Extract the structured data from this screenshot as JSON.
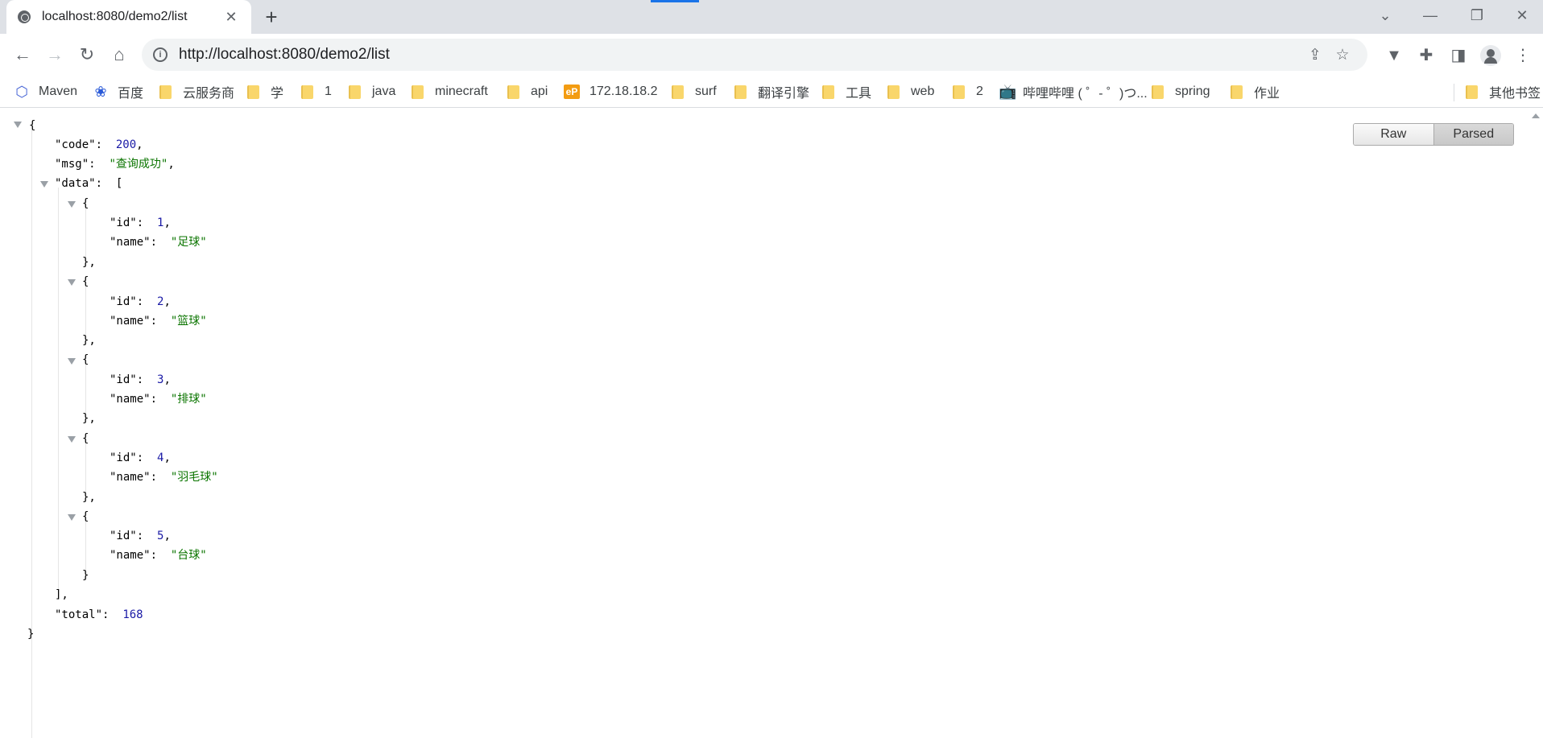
{
  "browser": {
    "tab": {
      "title": "localhost:8080/demo2/list"
    },
    "url": "http://localhost:8080/demo2/list",
    "bookmarks": [
      {
        "label": "Maven",
        "icon": "hexagon-icon"
      },
      {
        "label": "百度",
        "icon": "baidu-paw-icon"
      },
      {
        "label": "云服务商",
        "icon": "folder-icon"
      },
      {
        "label": "学",
        "icon": "folder-icon"
      },
      {
        "label": "1",
        "icon": "folder-icon"
      },
      {
        "label": "java",
        "icon": "folder-icon"
      },
      {
        "label": "minecraft",
        "icon": "folder-icon"
      },
      {
        "label": "api",
        "icon": "folder-icon"
      },
      {
        "label": "172.18.18.2",
        "icon": "ep-icon"
      },
      {
        "label": "surf",
        "icon": "folder-icon"
      },
      {
        "label": "翻译引擎",
        "icon": "folder-icon"
      },
      {
        "label": "工具",
        "icon": "folder-icon"
      },
      {
        "label": "web",
        "icon": "folder-icon"
      },
      {
        "label": "2",
        "icon": "folder-icon"
      },
      {
        "label": "哔哩哔哩 ( ゜- ゜)つ...",
        "icon": "bilibili-icon"
      },
      {
        "label": "spring",
        "icon": "folder-icon"
      },
      {
        "label": "作业",
        "icon": "folder-icon"
      }
    ],
    "other_bookmarks": "其他书签",
    "ep_text": "eP"
  },
  "viewer": {
    "raw_label": "Raw",
    "parsed_label": "Parsed"
  },
  "json": {
    "open_brace": "{",
    "code_key": "\"code\"",
    "code_value": "200",
    "msg_key": "\"msg\"",
    "msg_value": "\"查询成功\"",
    "data_key": "\"data\"",
    "open_bracket": "[",
    "close_bracket": "],",
    "items": [
      {
        "id": "1",
        "name": "\"足球\""
      },
      {
        "id": "2",
        "name": "\"篮球\""
      },
      {
        "id": "3",
        "name": "\"排球\""
      },
      {
        "id": "4",
        "name": "\"羽毛球\""
      },
      {
        "id": "5",
        "name": "\"台球\""
      }
    ],
    "id_key": "\"id\"",
    "name_key": "\"name\"",
    "total_key": "\"total\"",
    "total_value": "168",
    "close_brace": "}"
  }
}
